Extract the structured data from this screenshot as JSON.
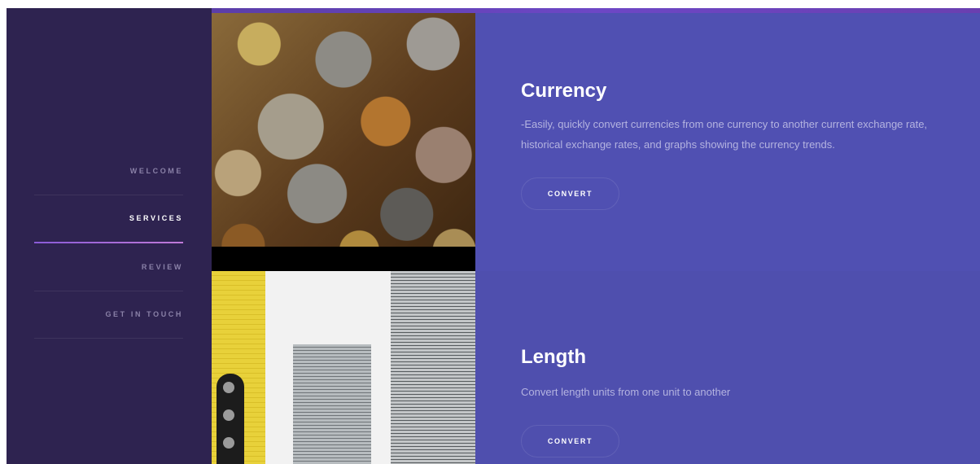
{
  "sidebar": {
    "items": [
      {
        "label": "WELCOME"
      },
      {
        "label": "SERVICES"
      },
      {
        "label": "REVIEW"
      },
      {
        "label": "GET IN TOUCH"
      }
    ]
  },
  "services": [
    {
      "title": "Currency",
      "description": "-Easily, quickly convert currencies from one currency to another current exchange rate, historical exchange rates, and graphs showing the currency trends.",
      "button_label": "CONVERT",
      "image": "coins-photo"
    },
    {
      "title": "Length",
      "description": "Convert length units from one unit to another",
      "button_label": "CONVERT",
      "image": "rulers-photo"
    }
  ],
  "colors": {
    "sidebar_bg": "#2e2350",
    "card_bg": "#5050b2",
    "accent": "#8a5bd8"
  }
}
